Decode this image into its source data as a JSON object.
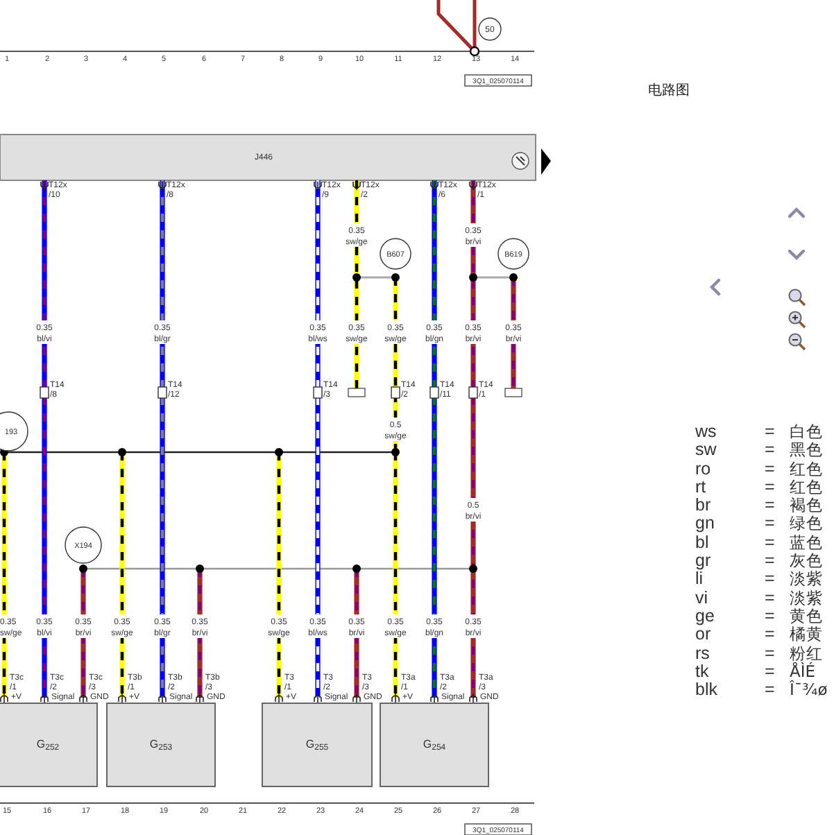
{
  "app_title": "电路图",
  "diagram": {
    "top_ruler": [
      "1",
      "2",
      "3",
      "4",
      "5",
      "6",
      "7",
      "8",
      "9",
      "10",
      "11",
      "12",
      "13",
      "14"
    ],
    "top_reference": "3Q1_025070114",
    "top_marker": "50",
    "control_unit": "J446",
    "splices": [
      {
        "label": "B607"
      },
      {
        "label": "B619"
      }
    ],
    "buses": [
      {
        "label": "193"
      },
      {
        "label": "X194"
      }
    ],
    "wires": [
      {
        "color": "#ffff00",
        "stripe": {
          "color": "#000000"
        },
        "terminal": false,
        "labels": [
          {
            "size": "0.35",
            "code": "sw/ge"
          }
        ],
        "bottom_pin": {
          "name": "T3c",
          "pin": "/1",
          "signal": "+V"
        }
      },
      {
        "color": "#0000ff",
        "stripe": {
          "color": "#800080"
        },
        "terminal": false,
        "top_pin": {
          "name": "T12x",
          "pin": "/10"
        },
        "labels": [
          {
            "size": "0.35",
            "code": "bl/vi"
          },
          {
            "size": "0.35",
            "code": "bl/vi"
          }
        ],
        "connector": {
          "name": "T14",
          "pin": "/8"
        },
        "bottom_pin": {
          "name": "T3c",
          "pin": "/2",
          "signal": "Signal"
        }
      },
      {
        "color": "#a52a2a",
        "stripe": {
          "color": "#800080"
        },
        "terminal": false,
        "labels": [
          {
            "size": "0.35",
            "code": "br/vi"
          }
        ],
        "bottom_pin": {
          "name": "T3c",
          "pin": "/3",
          "signal": "GND"
        }
      },
      {
        "color": "#ffff00",
        "stripe": {
          "color": "#000000"
        },
        "terminal": false,
        "labels": [
          {
            "size": "0.35",
            "code": "sw/ge"
          }
        ],
        "bottom_pin": {
          "name": "T3b",
          "pin": "/1",
          "signal": "+V"
        }
      },
      {
        "color": "#0000ff",
        "stripe": {
          "color": "#808080"
        },
        "terminal": false,
        "top_pin": {
          "name": "T12x",
          "pin": "/8"
        },
        "labels": [
          {
            "size": "0.35",
            "code": "bl/gr"
          },
          {
            "size": "0.35",
            "code": "bl/gr"
          }
        ],
        "connector": {
          "name": "T14",
          "pin": "/12"
        },
        "bottom_pin": {
          "name": "T3b",
          "pin": "/2",
          "signal": "Signal"
        }
      },
      {
        "color": "#a52a2a",
        "stripe": {
          "color": "#800080"
        },
        "terminal": false,
        "labels": [
          {
            "size": "0.35",
            "code": "br/vi"
          }
        ],
        "bottom_pin": {
          "name": "T3b",
          "pin": "/3",
          "signal": "GND"
        }
      },
      {
        "color": "#ffff00",
        "stripe": {
          "color": "#000000"
        },
        "terminal": false,
        "labels": [
          {
            "size": "0.35",
            "code": "sw/ge"
          }
        ],
        "bottom_pin": {
          "name": "T3",
          "pin": "/1",
          "signal": "+V"
        }
      },
      {
        "color": "#0000ff",
        "stripe": {
          "color": "#f4f4f4"
        },
        "terminal": false,
        "top_pin": {
          "name": "T12x",
          "pin": "/9"
        },
        "labels": [
          {
            "size": "0.35",
            "code": "bl/ws"
          },
          {
            "size": "0.35",
            "code": "bl/ws"
          }
        ],
        "connector": {
          "name": "T14",
          "pin": "/3"
        },
        "bottom_pin": {
          "name": "T3",
          "pin": "/2",
          "signal": "Signal"
        }
      },
      {
        "color": "#ffff00",
        "stripe": {
          "color": "#000000"
        },
        "terminal": true,
        "top_pin": {
          "name": "T12x",
          "pin": "/2"
        },
        "labels": [
          {
            "size": "0.35",
            "code": "sw/ge"
          },
          {
            "size": "0.35",
            "code": "sw/ge"
          }
        ]
      },
      {
        "color": "#a52a2a",
        "stripe": {
          "color": "#800080"
        },
        "terminal": false,
        "labels": [
          {
            "size": "0.35",
            "code": "br/vi"
          }
        ],
        "bottom_pin": {
          "name": "T3",
          "pin": "/3",
          "signal": "GND"
        }
      },
      {
        "color": "#ffff00",
        "stripe": {
          "color": "#000000"
        },
        "terminal": false,
        "labels": [
          {
            "size": "0.35",
            "code": "sw/ge"
          },
          {
            "size": "0.5",
            "code": "sw/ge"
          }
        ],
        "connector": {
          "name": "T14",
          "pin": "/2"
        }
      },
      {
        "color": "#ffff00",
        "stripe": {
          "color": "#000000"
        },
        "terminal": false,
        "labels": [
          {
            "size": "0.35",
            "code": "sw/ge"
          }
        ],
        "bottom_pin": {
          "name": "T3a",
          "pin": "/1",
          "signal": "+V"
        }
      },
      {
        "color": "#0000ff",
        "stripe": {
          "color": "#008000"
        },
        "terminal": false,
        "top_pin": {
          "name": "T12x",
          "pin": "/6"
        },
        "labels": [
          {
            "size": "0.35",
            "code": "bl/gn"
          },
          {
            "size": "0.35",
            "code": "bl/gn"
          }
        ],
        "connector": {
          "name": "T14",
          "pin": "/11"
        },
        "bottom_pin": {
          "name": "T3a",
          "pin": "/2",
          "signal": "Signal"
        }
      },
      {
        "color": "#a52a2a",
        "stripe": {
          "color": "#800080"
        },
        "terminal": false,
        "top_pin": {
          "name": "T12x",
          "pin": "/1"
        },
        "labels": [
          {
            "size": "0.35",
            "code": "br/vi"
          },
          {
            "size": "0.35",
            "code": "br/vi"
          },
          {
            "size": "0.5",
            "code": "br/vi"
          },
          {
            "size": "0.35",
            "code": "br/vi"
          }
        ],
        "connector": {
          "name": "T14",
          "pin": "/1"
        },
        "bottom_pin": {
          "name": "T3a",
          "pin": "/3",
          "signal": "GND"
        }
      },
      {
        "color": "#a52a2a",
        "stripe": {
          "color": "#800080"
        },
        "terminal": true,
        "labels": [
          {
            "size": "0.35",
            "code": "br/vi"
          }
        ]
      }
    ],
    "components": [
      {
        "letter": "G",
        "number": "252"
      },
      {
        "letter": "G",
        "number": "253"
      },
      {
        "letter": "G",
        "number": "255"
      },
      {
        "letter": "G",
        "number": "254"
      }
    ],
    "bottom_ruler": [
      "15",
      "16",
      "17",
      "18",
      "19",
      "20",
      "21",
      "22",
      "23",
      "24",
      "25",
      "26",
      "27",
      "28"
    ],
    "bottom_reference": "3Q1_025070114"
  },
  "legend": [
    {
      "code": "ws",
      "equals": "=",
      "meaning": "白色"
    },
    {
      "code": "sw",
      "equals": "=",
      "meaning": "黑色"
    },
    {
      "code": "ro",
      "equals": "=",
      "meaning": "红色"
    },
    {
      "code": "rt",
      "equals": "=",
      "meaning": "红色"
    },
    {
      "code": "br",
      "equals": "=",
      "meaning": "褐色"
    },
    {
      "code": "gn",
      "equals": "=",
      "meaning": "绿色"
    },
    {
      "code": "bl",
      "equals": "=",
      "meaning": "蓝色"
    },
    {
      "code": "gr",
      "equals": "=",
      "meaning": "灰色"
    },
    {
      "code": "li",
      "equals": "=",
      "meaning": "淡紫"
    },
    {
      "code": "vi",
      "equals": "=",
      "meaning": "淡紫"
    },
    {
      "code": "ge",
      "equals": "=",
      "meaning": "黄色"
    },
    {
      "code": "or",
      "equals": "=",
      "meaning": "橘黄"
    },
    {
      "code": "rs",
      "equals": "=",
      "meaning": "粉红"
    },
    {
      "code": "tk",
      "equals": "=",
      "meaning": "ÅÌÉ"
    },
    {
      "code": "blk",
      "equals": "=",
      "meaning": "Î¯¾ø"
    }
  ]
}
